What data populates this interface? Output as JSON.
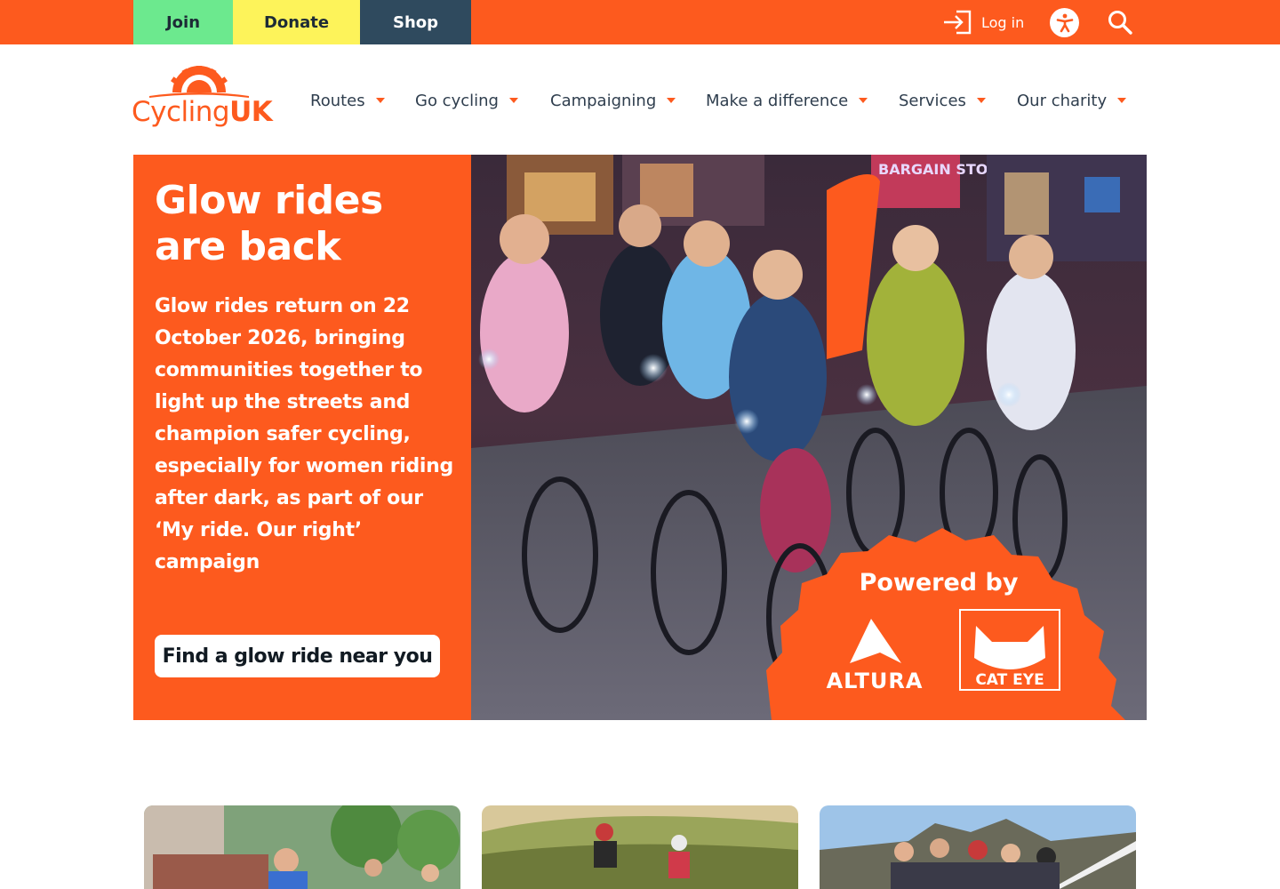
{
  "topbar": {
    "join_label": "Join",
    "donate_label": "Donate",
    "shop_label": "Shop",
    "login_label": "Log in",
    "colors": {
      "bar": "#fd5a1e",
      "join": "#6ce98e",
      "donate": "#fdf35a",
      "shop": "#2f4a5e"
    },
    "icons": [
      "login-icon",
      "accessibility-icon",
      "search-icon"
    ]
  },
  "header": {
    "logo_text_a": "Cycling",
    "logo_text_b": "UK",
    "nav": [
      {
        "label": "Routes"
      },
      {
        "label": "Go cycling"
      },
      {
        "label": "Campaigning"
      },
      {
        "label": "Make a difference"
      },
      {
        "label": "Services"
      },
      {
        "label": "Our charity"
      }
    ]
  },
  "hero": {
    "title": "Glow rides are back",
    "body": "Glow rides return on 22 October 2026, bringing communities together to light up the streets and champion safer cycling, especially for women riding after dark, as part of our ‘My ride. Our right’ campaign",
    "cta_label": "Find a glow ride near you",
    "image": {
      "badge_text": "Powered by",
      "sponsor_1": "ALTURA",
      "sponsor_2": "CAT EYE",
      "storefront_text": "BARGAIN STORE"
    },
    "accent": "#fd5a1e"
  },
  "cards": [
    {
      "image": "photo-riders-street"
    },
    {
      "image": "photo-riders-countryside"
    },
    {
      "image": "photo-riders-bridge"
    }
  ]
}
